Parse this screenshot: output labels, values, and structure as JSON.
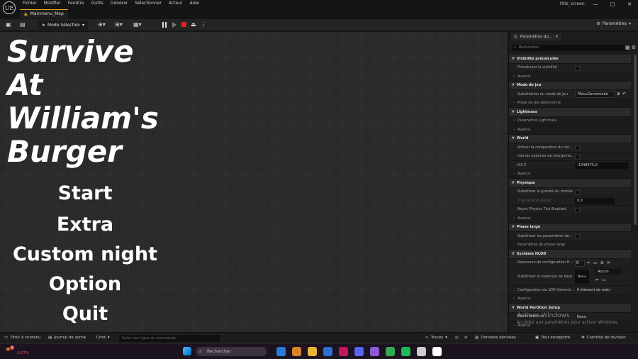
{
  "menubar": {
    "items": [
      "Fichier",
      "Modifier",
      "Fenêtre",
      "Outils",
      "Générer",
      "Sélectionner",
      "Acteur",
      "Aide"
    ],
    "project_title": "title_screen",
    "logo": "UE"
  },
  "tab": {
    "label": "Mainmenu_Map"
  },
  "toolbar": {
    "mode_label": "Mode Sélection",
    "params_label": "Paramètres"
  },
  "viewport": {
    "title_lines": [
      "Survive",
      "At",
      "William's",
      "Burger"
    ],
    "menu": [
      "Start",
      "Extra",
      "Custom night",
      "Option",
      "Quit"
    ]
  },
  "panel": {
    "tab_label": "Paramètres du...",
    "search_placeholder": "Rechercher",
    "rows": [
      {
        "kind": "sec",
        "label": "Visibilité précalculée"
      },
      {
        "kind": "prop",
        "label": "Précalculer la visibilité",
        "ctrl": "check"
      },
      {
        "kind": "adv",
        "label": "Avancé"
      },
      {
        "kind": "sec",
        "label": "Mode de jeu"
      },
      {
        "kind": "prop",
        "label": "Substitution du mode de jeu",
        "ctrl": "combo",
        "value": "MenuGamemode"
      },
      {
        "kind": "adv",
        "label": "Mode de jeu sélectionné"
      },
      {
        "kind": "sec",
        "label": "Lightmass"
      },
      {
        "kind": "adv",
        "label": "Paramètres Lightmass"
      },
      {
        "kind": "adv",
        "label": "Avancé"
      },
      {
        "kind": "sec",
        "label": "World"
      },
      {
        "kind": "prop",
        "label": "Activer la composition du mo...",
        "ctrl": "check"
      },
      {
        "kind": "prop",
        "label": "Use les volumes de chargeme...",
        "ctrl": "check"
      },
      {
        "kind": "prop",
        "label": "Kill Z",
        "ctrl": "field",
        "value": "-1048575,0"
      },
      {
        "kind": "adv",
        "label": "Avancé"
      },
      {
        "kind": "sec",
        "label": "Physique"
      },
      {
        "kind": "prop",
        "label": "Substituer la gravité du monde",
        "ctrl": "check"
      },
      {
        "kind": "prop",
        "label": "Z de gravité global",
        "ctrl": "field",
        "value": "0,0",
        "dim": true
      },
      {
        "kind": "prop",
        "label": "Async Physics Tick Enabled",
        "ctrl": "check"
      },
      {
        "kind": "adv",
        "label": "Avancé"
      },
      {
        "kind": "sec",
        "label": "Phase large"
      },
      {
        "kind": "prop",
        "label": "Substituer les paramètres de...",
        "ctrl": "check"
      },
      {
        "kind": "adv",
        "label": "Paramètres de phase large"
      },
      {
        "kind": "sec",
        "label": "Système HLOD"
      },
      {
        "kind": "prop",
        "label": "Ressource de configuration H...",
        "ctrl": "tiny",
        "value": "N"
      },
      {
        "kind": "hlod",
        "label": "Substituer le matériau de base",
        "none": "None",
        "aucun": "Aucun"
      },
      {
        "kind": "prop",
        "label": "Configuration du LOD hiérarch...",
        "ctrl": "text",
        "value": "0 élément de matr"
      },
      {
        "kind": "adv",
        "label": "Avancé"
      },
      {
        "kind": "sec",
        "label": "World Partition Setup"
      },
      {
        "kind": "prop",
        "label": "World Partition",
        "ctrl": "text",
        "value": "None"
      },
      {
        "kind": "adv",
        "label": "Avancé"
      }
    ]
  },
  "watermark": {
    "line1": "Activer Windows",
    "line2": "Accédez aux paramètres pour activer Windows."
  },
  "statusbar": {
    "drawer": "Tiroir à contenu",
    "log": "Journal de sortie",
    "cmd": "Cmd",
    "cmd_placeholder": "Saisir une ligne de commande",
    "traces": "Traces",
    "derived": "Données dérivées",
    "saved": "Tout enregistré",
    "revision": "Contrôle de révision"
  },
  "taskbar": {
    "search_placeholder": "Rechercher",
    "weather_value": "-0,27%",
    "badge": "1",
    "app_colors": [
      "#2a7bd8",
      "#d9822b",
      "#e8b339",
      "#2f6fd1",
      "#c2185b",
      "#5865f2",
      "#8c5ad8",
      "#33a852",
      "#1db954",
      "#cccccc",
      "#ffffff"
    ]
  }
}
